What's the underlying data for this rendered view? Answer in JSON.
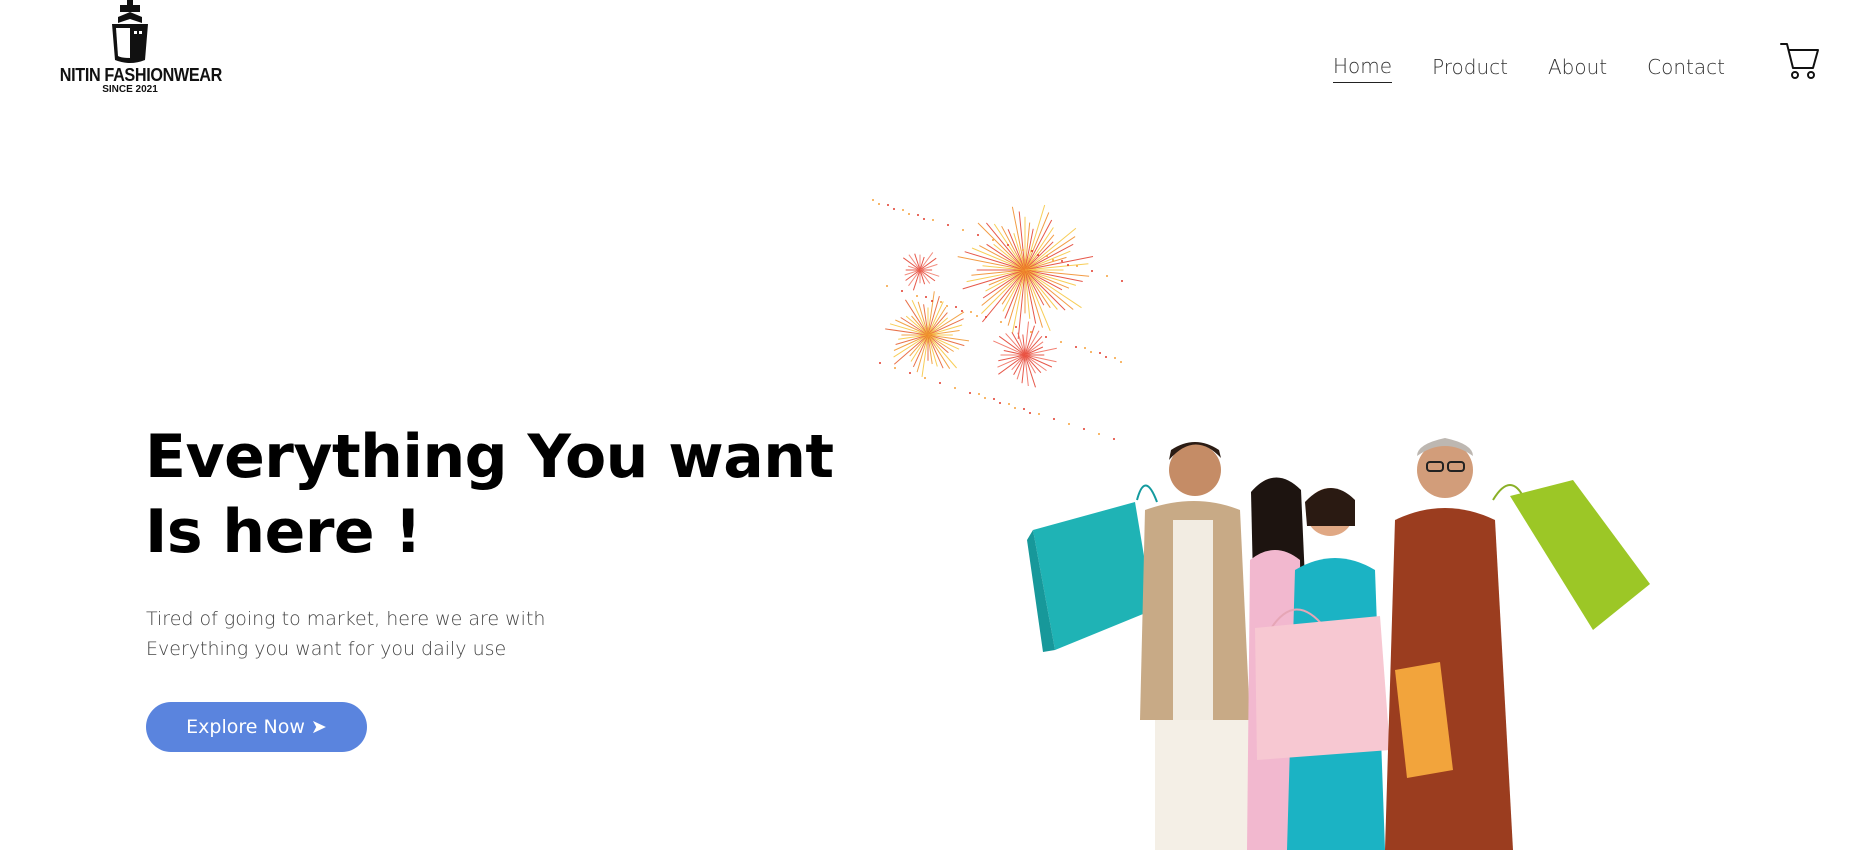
{
  "brand": {
    "name": "NITIN FASHIONWEAR",
    "since": "SINCE 2021",
    "logo_icon": "ship-bowtie-logo"
  },
  "nav": {
    "items": [
      {
        "label": "Home",
        "active": true
      },
      {
        "label": "Product",
        "active": false
      },
      {
        "label": "About",
        "active": false
      },
      {
        "label": "Contact",
        "active": false
      }
    ],
    "cart_icon": "shopping-cart-icon"
  },
  "hero": {
    "title_line1": "Everything You want",
    "title_line2": "Is here !",
    "subtitle_line1": "Tired of going to market, here we are with",
    "subtitle_line2": "Everything you want for you daily use",
    "cta_label": "Explore Now ➤"
  },
  "colors": {
    "accent": "#5a84de",
    "background": "#ffffff",
    "heading": "#000000",
    "body_text": "#444444"
  }
}
